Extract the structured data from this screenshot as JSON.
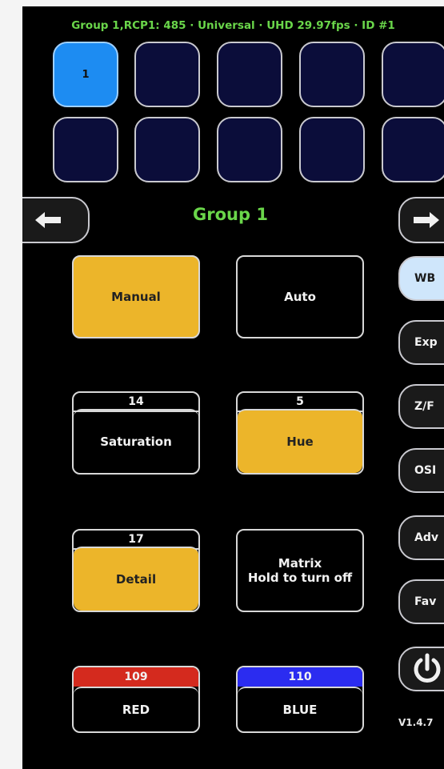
{
  "status_bar": "Group 1,RCP1: 485 · Universal · UHD 29.97fps · ID #1",
  "camera_grid": [
    "1",
    "",
    "",
    "",
    "",
    "",
    "",
    "",
    "",
    ""
  ],
  "group_title": "Group 1",
  "nav": {
    "prev_icon": "arrow-left-icon",
    "next_icon": "arrow-right-icon"
  },
  "wb_mode": {
    "manual": "Manual",
    "auto": "Auto",
    "selected": "Manual"
  },
  "params": {
    "saturation": {
      "value": "14",
      "label": "Saturation",
      "active": false
    },
    "hue": {
      "value": "5",
      "label": "Hue",
      "active": true
    },
    "detail": {
      "value": "17",
      "label": "Detail",
      "active": true
    }
  },
  "matrix": {
    "line1": "Matrix",
    "line2": "Hold to turn off"
  },
  "color_gain": {
    "red": {
      "value": "109",
      "label": "RED",
      "color": "#d42a1e"
    },
    "blue": {
      "value": "110",
      "label": "BLUE",
      "color": "#2b2cf0"
    }
  },
  "side_menu": [
    "WB",
    "Exp",
    "Z/F",
    "OSI",
    "Adv",
    "Fav"
  ],
  "side_menu_active": "WB",
  "power_icon": "power-icon",
  "version": "V1.4.7",
  "colors": {
    "accent_green": "#6ad64a",
    "active_amber": "#ecb52a",
    "selected_camera": "#1d8cf2"
  }
}
